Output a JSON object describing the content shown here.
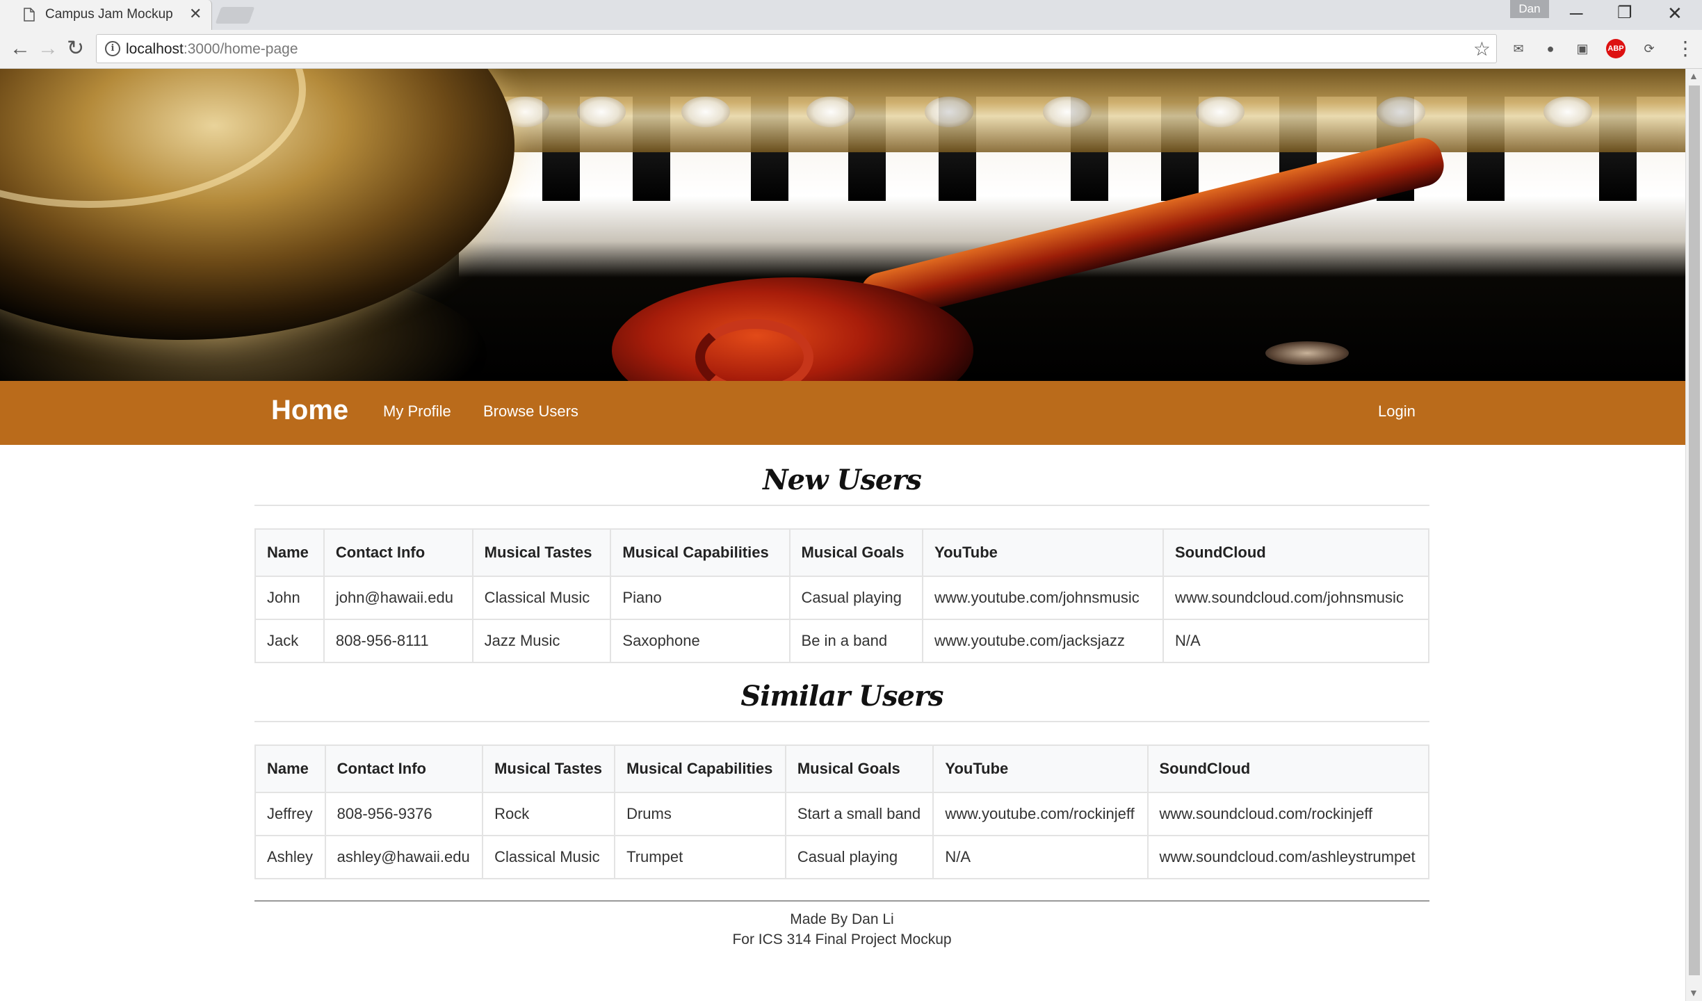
{
  "browser": {
    "tab_title": "Campus Jam Mockup",
    "tab_close": "✕",
    "profile_name": "Dan",
    "url_host": "localhost",
    "url_path": ":3000/home-page",
    "win_minimize": "─",
    "win_restore": "❐",
    "win_close": "✕",
    "back": "←",
    "forward": "→",
    "reload": "↻",
    "info": "i",
    "star": "☆",
    "menu": "⋮",
    "ext_mail": "✉",
    "ext_bulb": "●",
    "ext_box": "▣",
    "ext_abp": "ABP",
    "ext_sync": "⟳"
  },
  "navbar": {
    "brand": "Home",
    "links": [
      "My Profile",
      "Browse Users"
    ],
    "login": "Login",
    "color": "#ba6b1b"
  },
  "new_users": {
    "title": "New Users",
    "columns": [
      "Name",
      "Contact Info",
      "Musical Tastes",
      "Musical Capabilities",
      "Musical Goals",
      "YouTube",
      "SoundCloud"
    ],
    "rows": [
      [
        "John",
        "john@hawaii.edu",
        "Classical Music",
        "Piano",
        "Casual playing",
        "www.youtube.com/johnsmusic",
        "www.soundcloud.com/johnsmusic"
      ],
      [
        "Jack",
        "808-956-8111",
        "Jazz Music",
        "Saxophone",
        "Be in a band",
        "www.youtube.com/jacksjazz",
        "N/A"
      ]
    ]
  },
  "similar_users": {
    "title": "Similar Users",
    "columns": [
      "Name",
      "Contact Info",
      "Musical Tastes",
      "Musical Capabilities",
      "Musical Goals",
      "YouTube",
      "SoundCloud"
    ],
    "rows": [
      [
        "Jeffrey",
        "808-956-9376",
        "Rock",
        "Drums",
        "Start a small band",
        "www.youtube.com/rockinjeff",
        "www.soundcloud.com/rockinjeff"
      ],
      [
        "Ashley",
        "ashley@hawaii.edu",
        "Classical Music",
        "Trumpet",
        "Casual playing",
        "N/A",
        "www.soundcloud.com/ashleystrumpet"
      ]
    ]
  },
  "footer": {
    "line1": "Made By Dan Li",
    "line2": "For ICS 314 Final Project Mockup"
  }
}
